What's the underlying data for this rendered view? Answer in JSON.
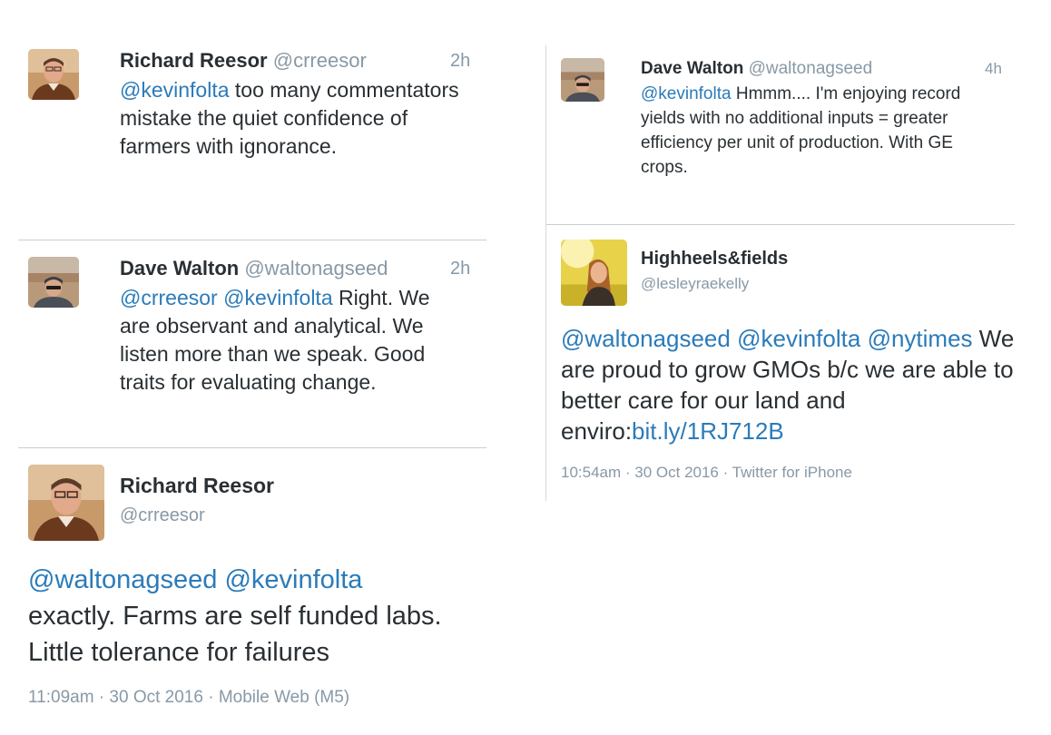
{
  "tweets": [
    {
      "name": "Richard Reesor",
      "handle": "@crreesor",
      "time": "2h",
      "mentions": [
        "@kevinfolta"
      ],
      "text": "too many commentators mistake the quiet confidence of farmers with ignorance."
    },
    {
      "name": "Dave Walton",
      "handle": "@waltonagseed",
      "time": "2h",
      "mentions": [
        "@crreesor",
        "@kevinfolta"
      ],
      "text": "Right.  We are observant and analytical.  We listen more than we speak.  Good traits for evaluating change."
    },
    {
      "name": "Richard Reesor",
      "handle": "@crreesor",
      "mentions": [
        "@waltonagseed",
        "@kevinfolta"
      ],
      "text": "exactly.  Farms are self funded labs. Little tolerance for failures",
      "meta": "11:09am · 30 Oct 2016 · Mobile Web (M5)"
    },
    {
      "name": "Dave Walton",
      "handle": "@waltonagseed",
      "time": "4h",
      "mentions": [
        "@kevinfolta"
      ],
      "text": "Hmmm....  I'm enjoying record yields with no additional inputs = greater efficiency per unit of production. With GE crops."
    },
    {
      "name": "Highheels&fields",
      "handle": "@lesleyraekelly",
      "mentions": [
        "@waltonagseed",
        "@kevinfolta",
        "@nytimes"
      ],
      "text": "We are proud to grow GMOs b/c we are able to better care for our land and enviro:",
      "link": "bit.ly/1RJ712B",
      "meta": "10:54am · 30 Oct 2016 · Twitter for iPhone"
    }
  ],
  "colors": {
    "link": "#2b7bb9",
    "muted": "#8899a6",
    "text": "#292f33",
    "divider": "#c9cdd2"
  }
}
